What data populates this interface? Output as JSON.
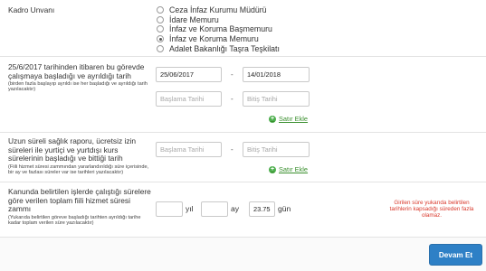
{
  "kadro": {
    "label": "Kadro Unvanı",
    "options": [
      {
        "label": "Ceza İnfaz Kurumu Müdürü",
        "checked": false
      },
      {
        "label": "İdare Memuru",
        "checked": false
      },
      {
        "label": "İnfaz ve Koruma Başmemuru",
        "checked": false
      },
      {
        "label": "İnfaz ve Koruma Memuru",
        "checked": true
      },
      {
        "label": "Adalet Bakanlığı Taşra Teşkilatı",
        "checked": false
      }
    ]
  },
  "gorev": {
    "label": "25/6/2017 tarihinden itibaren bu görevde çalışmaya başladığı ve ayrıldığı tarih",
    "note": "(birden fazla başlayıp ayrıldı ise her başladığı ve ayrıldığı tarih yazılacaktır)",
    "row1_start": "25/06/2017",
    "row1_end": "14/01/2018",
    "start_placeholder": "Başlama Tarihi",
    "end_placeholder": "Bitiş Tarihi",
    "add_row_label": "Satır Ekle"
  },
  "rapor": {
    "label": "Uzun süreli sağlık raporu, ücretsiz izin süreleri ile yurtiçi ve yurtdışı kurs sürelerinin başladığı ve bittiği tarih",
    "note": "(Fiili hizmet süresi zammından yararlandırıldığı süre içerisinde, bir ay ve fazlası süreler var ise tarihleri yazılacaktır)",
    "start_placeholder": "Başlama Tarihi",
    "end_placeholder": "Bitiş Tarihi",
    "add_row_label": "Satır Ekle"
  },
  "zam": {
    "label": "Kanunda belirtilen işlerde çalıştığı sürelere göre verilen toplam fiili hizmet süresi zammı",
    "note": "(Yukarıda belirtilen göreve başladığı tarihten ayrıldığı tarihe kadar toplam verilen süre yazılacaktır)",
    "year_value": "",
    "year_unit": "yıl",
    "month_value": "",
    "month_unit": "ay",
    "day_value": "23.75",
    "day_unit": "gün",
    "warning": "Girilen süre yukarıda belirtilen tarihlerin kapsadığı süreden fazla olamaz."
  },
  "footer": {
    "continue_label": "Devam Et"
  },
  "colors": {
    "accent": "#2e80c6",
    "link": "#3a8f2e",
    "warning": "#d9382b"
  }
}
